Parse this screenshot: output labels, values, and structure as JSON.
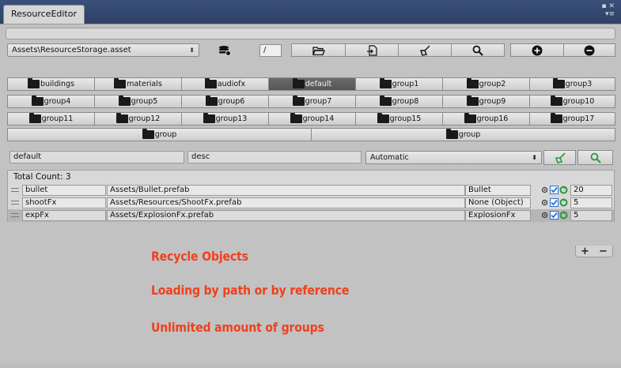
{
  "window": {
    "tab_title": "ResourceEditor",
    "controls": "▪ ✕\n▾≡"
  },
  "toolbar": {
    "asset_path": "Assets\\ResourceStorage.asset",
    "field_value": "/",
    "icons": [
      "database-add-icon",
      "folder-open-icon",
      "import-icon",
      "broom-icon",
      "search-icon",
      "add-circle-icon",
      "remove-circle-icon"
    ]
  },
  "groups": {
    "row1": [
      "buildings",
      "materials",
      "audiofx",
      "default",
      "group1",
      "group2",
      "group3"
    ],
    "row2": [
      "group4",
      "group5",
      "group6",
      "group7",
      "group8",
      "group9",
      "group10"
    ],
    "row3": [
      "group11",
      "group12",
      "group13",
      "group14",
      "group15",
      "group16",
      "group17"
    ],
    "row4": [
      "group",
      "group"
    ],
    "active": "default"
  },
  "filter": {
    "name": "default",
    "desc": "desc",
    "mode": "Automatic"
  },
  "list": {
    "total_label": "Total Count: 3",
    "rows": [
      {
        "name": "bullet",
        "path": "Assets/Bullet.prefab",
        "ref": "Bullet",
        "count": "20"
      },
      {
        "name": "shootFx",
        "path": "Assets/Resources/ShootFx.prefab",
        "ref": "None (Object)",
        "count": "5"
      },
      {
        "name": "expFx",
        "path": "Assets/ExplosionFx.prefab",
        "ref": "ExplosionFx",
        "count": "5"
      }
    ],
    "add": "+",
    "remove": "−"
  },
  "promo": {
    "line1": "Recycle Objects",
    "line2": "Loading by path or by reference",
    "line3": "Unlimited amount of groups"
  },
  "colors": {
    "promo": "#f0401c",
    "active_group": "#5f5f5f",
    "check": "#2c6fd0",
    "recycle": "#2a9a3a"
  }
}
